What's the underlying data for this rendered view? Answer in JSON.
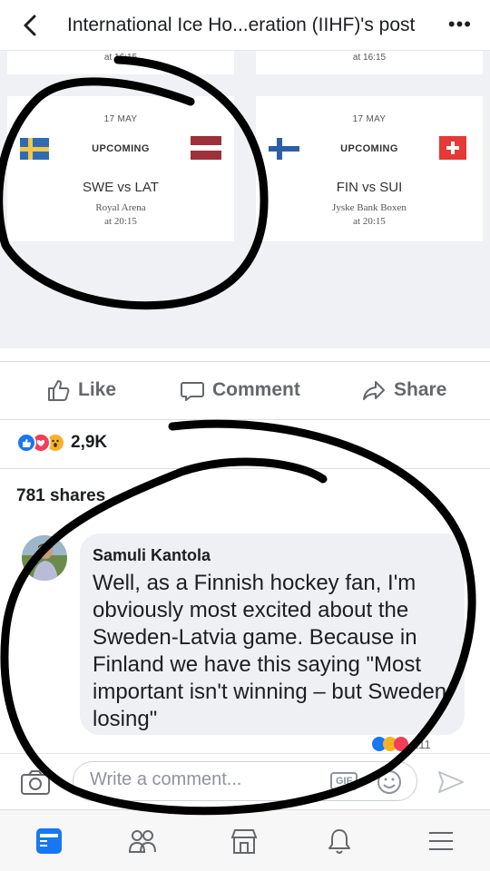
{
  "header": {
    "title": "International Ice Ho...eration (IIHF)'s post",
    "more_label": "•••"
  },
  "schedule": {
    "top_left_time": "at 16:15",
    "top_right_time": "at 16:15",
    "cards": [
      {
        "date": "17 MAY",
        "status": "UPCOMING",
        "match": "SWE vs LAT",
        "venue": "Royal Arena",
        "time": "at 20:15",
        "home_flag": "sweden-flag",
        "away_flag": "latvia-flag"
      },
      {
        "date": "17 MAY",
        "status": "UPCOMING",
        "match": "FIN vs SUI",
        "venue": "Jyske Bank Boxen",
        "time": "at 20:15",
        "home_flag": "finland-flag",
        "away_flag": "switzerland-flag"
      }
    ]
  },
  "actions": {
    "like": "Like",
    "comment": "Comment",
    "share": "Share"
  },
  "stats": {
    "reaction_count": "2,9K",
    "shares": "781 shares"
  },
  "comment": {
    "author": "Samuli Kantola",
    "text": "Well, as a Finnish hockey fan, I'm obviously most excited about the Sweden-Latvia game. Because in Finland we have this saying \"Most important isn't winning – but Sweden losing\"",
    "reaction_count": "211"
  },
  "composer": {
    "placeholder": "Write a comment...",
    "gif_label": "GIF"
  },
  "colors": {
    "facebook_blue": "#1877f2",
    "latvia_red": "#9e3039",
    "annotation": "#000000"
  }
}
